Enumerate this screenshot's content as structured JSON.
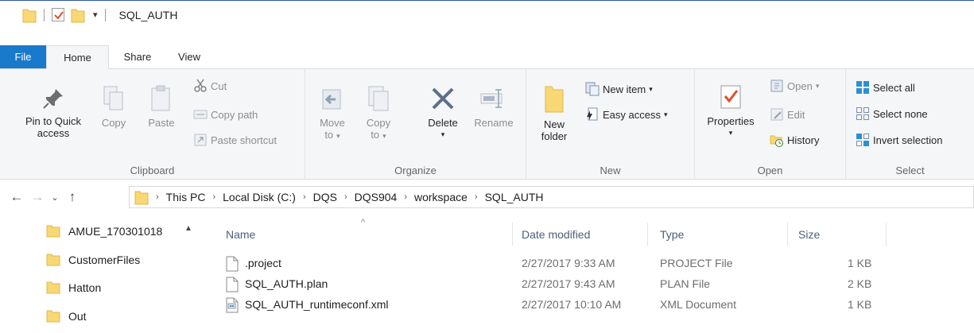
{
  "window": {
    "title": "SQL_AUTH"
  },
  "tabs": [
    "File",
    "Home",
    "Share",
    "View"
  ],
  "ribbon": {
    "clipboard": {
      "label": "Clipboard",
      "pin_line1": "Pin to Quick",
      "pin_line2": "access",
      "copy": "Copy",
      "paste": "Paste",
      "cut": "Cut",
      "copy_path": "Copy path",
      "paste_shortcut": "Paste shortcut"
    },
    "organize": {
      "label": "Organize",
      "move_line1": "Move",
      "move_line2": "to",
      "copy_line1": "Copy",
      "copy_line2": "to",
      "delete": "Delete",
      "rename": "Rename"
    },
    "new": {
      "label": "New",
      "folder_line1": "New",
      "folder_line2": "folder",
      "new_item": "New item",
      "easy_access": "Easy access"
    },
    "open": {
      "label": "Open",
      "properties": "Properties",
      "open": "Open",
      "edit": "Edit",
      "history": "History"
    },
    "select": {
      "label": "Select",
      "select_all": "Select all",
      "select_none": "Select none",
      "invert": "Invert selection"
    }
  },
  "address": {
    "crumbs": [
      "This PC",
      "Local Disk (C:)",
      "DQS",
      "DQS904",
      "workspace",
      "SQL_AUTH"
    ]
  },
  "nav": {
    "items": [
      "AMUE_170301018",
      "CustomerFiles",
      "Hatton",
      "Out"
    ]
  },
  "columns": {
    "name": "Name",
    "date": "Date modified",
    "type": "Type",
    "size": "Size"
  },
  "files": [
    {
      "name": ".project",
      "date": "2/27/2017 9:33 AM",
      "type": "PROJECT File",
      "size": "1 KB",
      "icon": "file-icon"
    },
    {
      "name": "SQL_AUTH.plan",
      "date": "2/27/2017 9:43 AM",
      "type": "PLAN File",
      "size": "2 KB",
      "icon": "file-icon"
    },
    {
      "name": "SQL_AUTH_runtimeconf.xml",
      "date": "2/27/2017 10:10 AM",
      "type": "XML Document",
      "size": "1 KB",
      "icon": "xml-file-icon"
    }
  ],
  "colors": {
    "file_tab": "#1979ca",
    "folder": "#f8d775",
    "accent": "#2b579a"
  }
}
